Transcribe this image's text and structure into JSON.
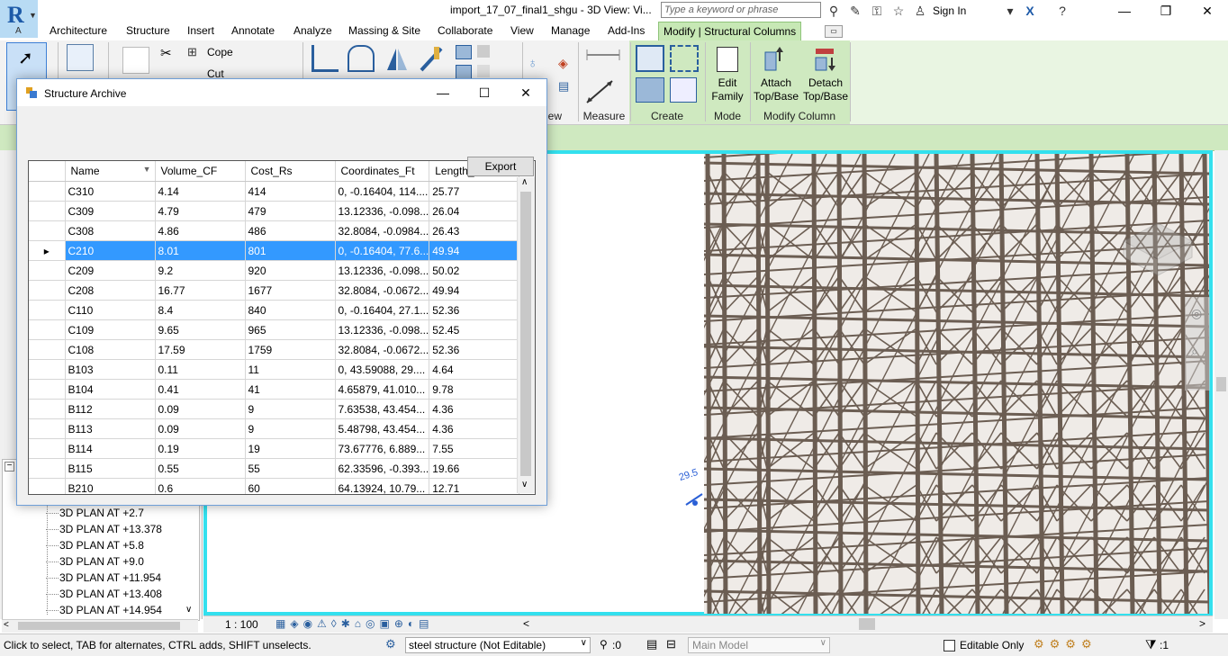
{
  "app": {
    "title": "import_17_07_final1_shgu - 3D View: Vi...",
    "logo_letter": "R",
    "logo_sub": "A",
    "search_placeholder": "Type a keyword or phrase",
    "sign_in": "Sign In"
  },
  "tabs": [
    "Architecture",
    "Structure",
    "Insert",
    "Annotate",
    "Analyze",
    "Massing & Site",
    "Collaborate",
    "View",
    "Manage",
    "Add-Ins",
    "Modify | Structural Columns"
  ],
  "ribbon": {
    "cope_label": "Cope",
    "cut_label": "Cut",
    "view_panel_label": "iew",
    "measure_label": "Measure",
    "create_label": "Create",
    "mode_label": "Mode",
    "modify_column_label": "Modify Column",
    "edit_family": [
      "Edit",
      "Family"
    ],
    "attach": [
      "Attach",
      "Top/Base"
    ],
    "detach": [
      "Detach",
      "Top/Base"
    ]
  },
  "left_panel": {
    "views": [
      "3D PLAN AT  +2.7",
      "3D PLAN AT  +13.378",
      "3D PLAN AT  +5.8",
      "3D PLAN AT  +9.0",
      "3D PLAN AT  +11.954",
      "3D PLAN AT  +13.408",
      "3D PLAN AT  +14.954"
    ]
  },
  "viewport": {
    "dimension": "29.5"
  },
  "dialog": {
    "title": "Structure Archive",
    "export_label": "Export",
    "columns": [
      "Name",
      "Volume_CF",
      "Cost_Rs",
      "Coordinates_Ft",
      "Length_"
    ],
    "selected_row": 3,
    "rows": [
      [
        "C310",
        "4.14",
        "414",
        "0, -0.16404, 114....",
        "25.77"
      ],
      [
        "C309",
        "4.79",
        "479",
        "13.12336, -0.098...",
        "26.04"
      ],
      [
        "C308",
        "4.86",
        "486",
        "32.8084, -0.0984...",
        "26.43"
      ],
      [
        "C210",
        "8.01",
        "801",
        "0, -0.16404, 77.6...",
        "49.94"
      ],
      [
        "C209",
        "9.2",
        "920",
        "13.12336, -0.098...",
        "50.02"
      ],
      [
        "C208",
        "16.77",
        "1677",
        "32.8084, -0.0672...",
        "49.94"
      ],
      [
        "C110",
        "8.4",
        "840",
        "0, -0.16404, 27.1...",
        "52.36"
      ],
      [
        "C109",
        "9.65",
        "965",
        "13.12336, -0.098...",
        "52.45"
      ],
      [
        "C108",
        "17.59",
        "1759",
        "32.8084, -0.0672...",
        "52.36"
      ],
      [
        "B103",
        "0.11",
        "11",
        "0, 43.59088, 29....",
        "4.64"
      ],
      [
        "B104",
        "0.41",
        "41",
        "4.65879, 41.010...",
        "9.78"
      ],
      [
        "B112",
        "0.09",
        "9",
        "7.63538, 43.454...",
        "4.36"
      ],
      [
        "B113",
        "0.09",
        "9",
        "5.48798, 43.454...",
        "4.36"
      ],
      [
        "B114",
        "0.19",
        "19",
        "73.67776, 6.889...",
        "7.55"
      ],
      [
        "B115",
        "0.55",
        "55",
        "62.33596, -0.393...",
        "19.66"
      ],
      [
        "B210",
        "0.6",
        "60",
        "64.13924, 10.79...",
        "12.71"
      ]
    ]
  },
  "status": {
    "message": "Click to select, TAB for alternates, CTRL adds, SHIFT unselects.",
    "scale": "1 : 100",
    "workset": "steel structure (Not Editable)",
    "sel_count": ":0",
    "design_option": "Main Model",
    "editable_only": "Editable Only",
    "filter_count": ":1"
  },
  "colors": {
    "viewport_border": "#33e0ee",
    "context_tab": "#c7e8b5",
    "selection": "#3399ff",
    "steel": "#6b5d52"
  }
}
